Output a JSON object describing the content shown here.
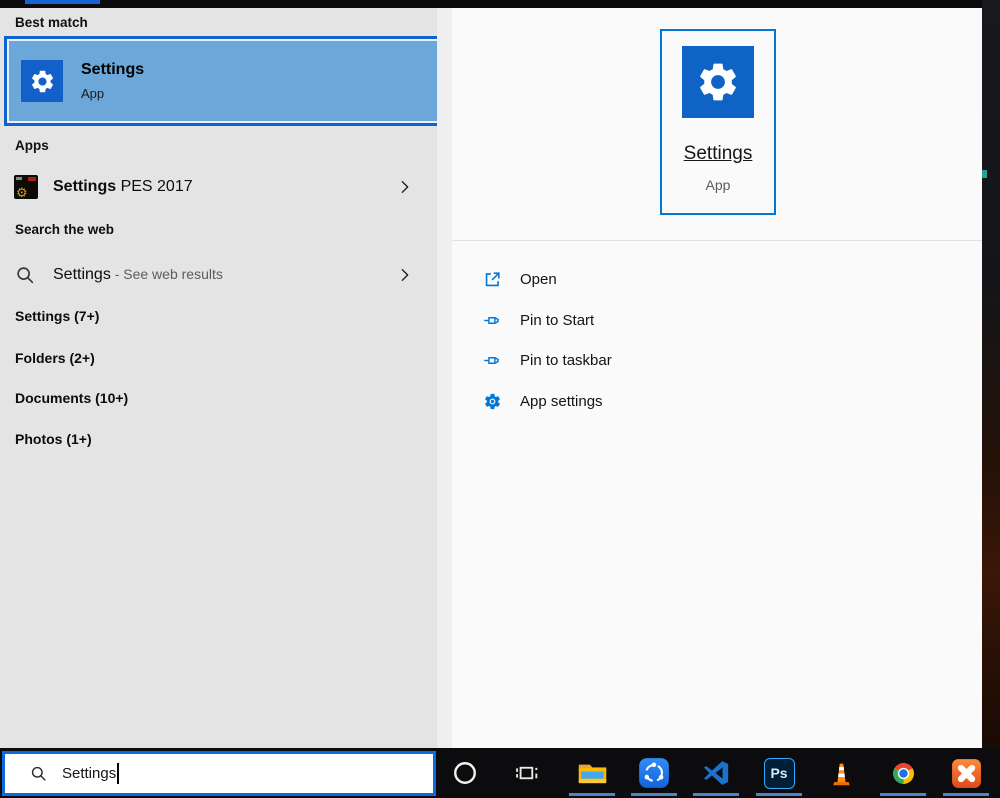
{
  "search_panel": {
    "best_match_header": "Best match",
    "best_match": {
      "app_name": "Settings",
      "app_type": "App"
    },
    "apps_header": "Apps",
    "app_result": {
      "bold": "Settings",
      "rest": " PES 2017"
    },
    "web_header": "Search the web",
    "web_result": {
      "bold": "Settings",
      "rest": " - See web results"
    },
    "categories": [
      "Settings (7+)",
      "Folders (2+)",
      "Documents (10+)",
      "Photos (1+)"
    ]
  },
  "preview_panel": {
    "app_name": "Settings",
    "app_type": "App",
    "actions": [
      {
        "label": "Open",
        "icon": "open-icon"
      },
      {
        "label": "Pin to Start",
        "icon": "pin-icon"
      },
      {
        "label": "Pin to taskbar",
        "icon": "pin-icon"
      },
      {
        "label": "App settings",
        "icon": "gear-outline-icon"
      }
    ]
  },
  "search_box": {
    "value": "Settings",
    "icon": "search-icon"
  },
  "taskbar": {
    "ps_label": "Ps",
    "icons": [
      "cortana",
      "task-view",
      "file-explorer",
      "shareit",
      "vscode",
      "photoshop",
      "vlc",
      "chrome",
      "xampp"
    ],
    "running_indicator_color": "#4a86c8"
  },
  "colors": {
    "selection_fill": "#6ba7d8",
    "selection_border": "#0d63d1",
    "accent_blue": "#0078d7",
    "app_tile_blue": "#1161c9",
    "left_panel_bg": "#e4e4e4",
    "right_panel_bg": "#fafafa",
    "taskbar_bg": "#0c0c0e"
  }
}
